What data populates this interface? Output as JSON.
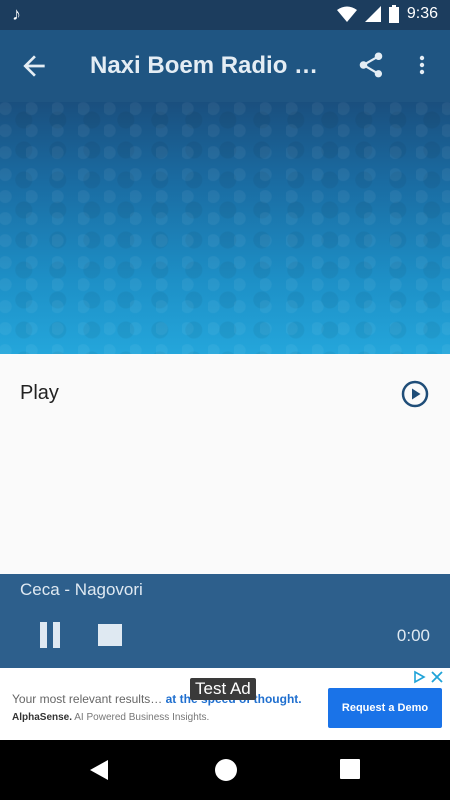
{
  "status_bar": {
    "time": "9:36",
    "icons": [
      "music-note-icon",
      "wifi-icon",
      "signal-icon",
      "battery-icon"
    ]
  },
  "app_bar": {
    "title": "Naxi Boem Radio B…",
    "back_icon": "arrow-back-icon",
    "share_icon": "share-icon",
    "more_icon": "more-vert-icon"
  },
  "list": {
    "play_label": "Play"
  },
  "player": {
    "track": "Ceca - Nagovori",
    "time": "0:00"
  },
  "ad": {
    "badge": "Test Ad",
    "headline_plain": "Your most relevant results… ",
    "headline_accent": "at the speed of thought.",
    "brand_name": "AlphaSense.",
    "brand_tagline": " AI Powered Business Insights.",
    "cta": "Request a Demo"
  },
  "colors": {
    "app_bar": "#1f5582",
    "status_bar": "#1c3d5e",
    "player": "#2d5f8c",
    "cta": "#1a73e8"
  }
}
